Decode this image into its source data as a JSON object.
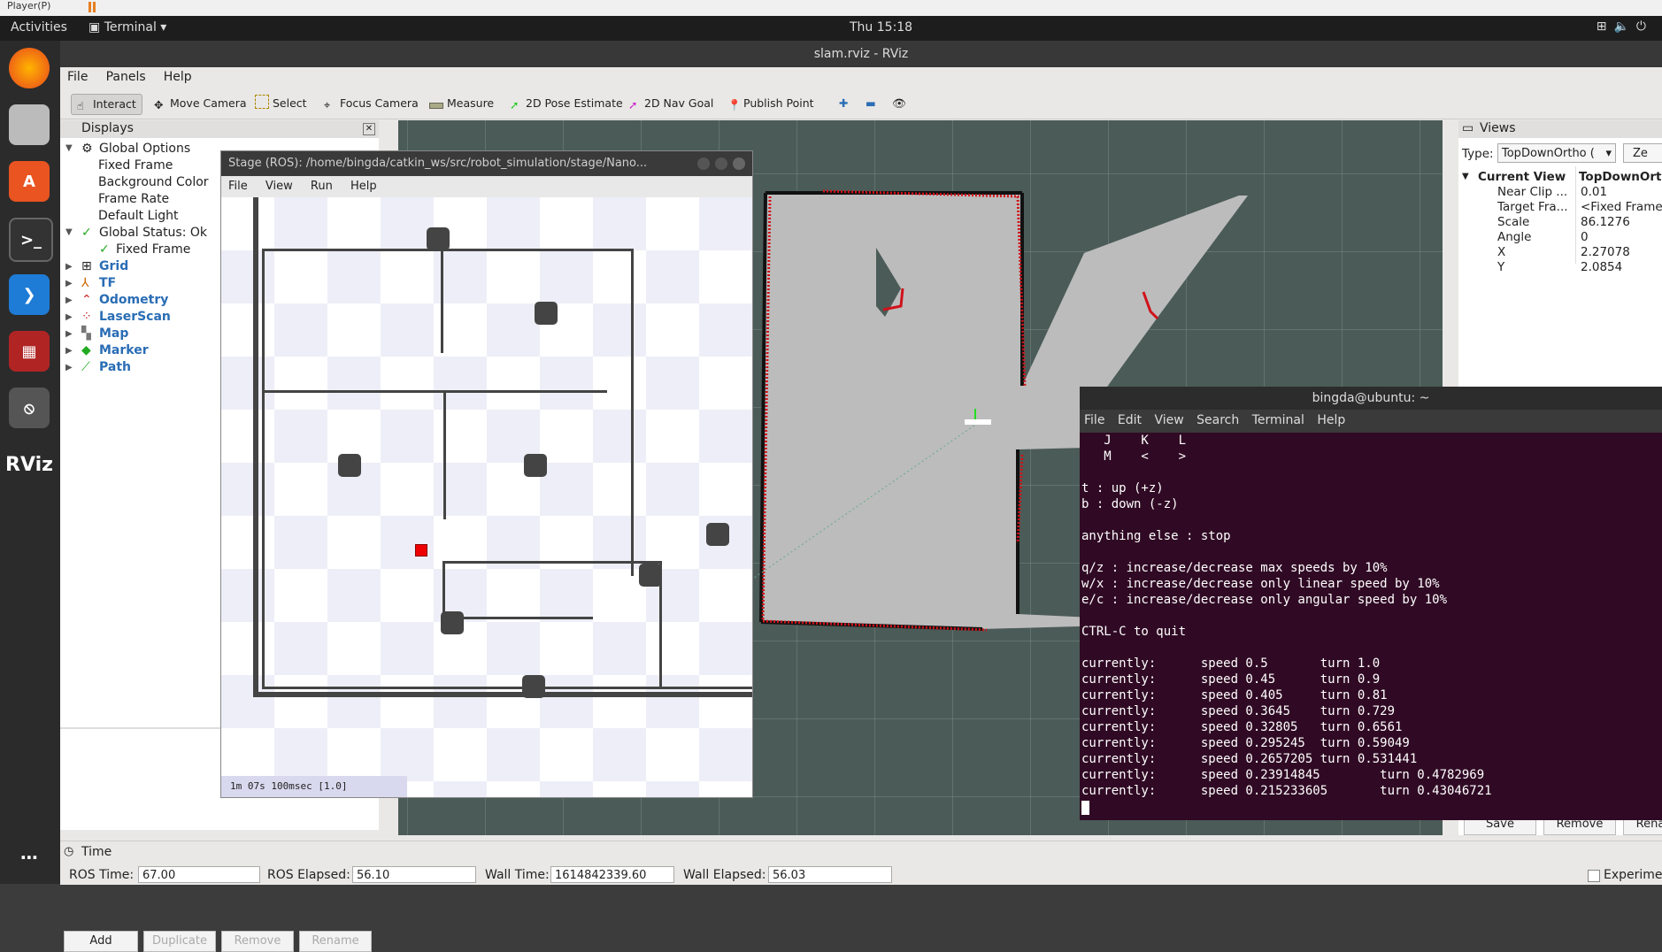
{
  "vm": {
    "player_label": "Player(P)"
  },
  "topbar": {
    "activities": "Activities",
    "app": "Terminal",
    "clock": "Thu 15:18"
  },
  "rviz": {
    "title": "slam.rviz - RViz",
    "menu": [
      "File",
      "Panels",
      "Help"
    ],
    "tools": [
      "Interact",
      "Move Camera",
      "Select",
      "Focus Camera",
      "Measure",
      "2D Pose Estimate",
      "2D Nav Goal",
      "Publish Point"
    ]
  },
  "displays": {
    "header": "Displays",
    "items": {
      "global_options": "Global Options",
      "fixed_frame": "Fixed Frame",
      "background_color": "Background Color",
      "frame_rate": "Frame Rate",
      "default_light": "Default Light",
      "global_status": "Global Status: Ok",
      "status_fixed_frame": "Fixed Frame",
      "grid": "Grid",
      "tf": "TF",
      "odometry": "Odometry",
      "laserscan": "LaserScan",
      "map": "Map",
      "marker": "Marker",
      "path": "Path"
    },
    "buttons": {
      "add": "Add",
      "duplicate": "Duplicate",
      "remove": "Remove",
      "rename": "Rename"
    }
  },
  "stage": {
    "title": "Stage (ROS): /home/bingda/catkin_ws/src/robot_simulation/stage/Nano...",
    "menu": [
      "File",
      "View",
      "Run",
      "Help"
    ],
    "status": "1m 07s 100msec [1.0]"
  },
  "views": {
    "header": "Views",
    "type_label": "Type:",
    "type_value": "TopDownOrtho (",
    "zero_button": "Ze",
    "current_view": "Current View",
    "current_view_value": "TopDownOrtho",
    "props": [
      {
        "name": "Near Clip ...",
        "value": "0.01"
      },
      {
        "name": "Target Fra...",
        "value": "<Fixed Frame"
      },
      {
        "name": "Scale",
        "value": "86.1276"
      },
      {
        "name": "Angle",
        "value": "0"
      },
      {
        "name": "X",
        "value": "2.27078"
      },
      {
        "name": "Y",
        "value": "2.0854"
      }
    ],
    "buttons": {
      "save": "Save",
      "remove": "Remove",
      "rename": "Rena"
    }
  },
  "terminal": {
    "title": "bingda@ubuntu: ~",
    "menu": [
      "File",
      "Edit",
      "View",
      "Search",
      "Terminal",
      "Help"
    ],
    "lines": [
      "   J    K    L",
      "   M    <    >",
      "",
      "t : up (+z)",
      "b : down (-z)",
      "",
      "anything else : stop",
      "",
      "q/z : increase/decrease max speeds by 10%",
      "w/x : increase/decrease only linear speed by 10%",
      "e/c : increase/decrease only angular speed by 10%",
      "",
      "CTRL-C to quit",
      "",
      "currently:      speed 0.5       turn 1.0",
      "currently:      speed 0.45      turn 0.9",
      "currently:      speed 0.405     turn 0.81",
      "currently:      speed 0.3645    turn 0.729",
      "currently:      speed 0.32805   turn 0.6561",
      "currently:      speed 0.295245  turn 0.59049",
      "currently:      speed 0.2657205 turn 0.531441",
      "currently:      speed 0.23914845        turn 0.4782969",
      "currently:      speed 0.215233605       turn 0.43046721"
    ]
  },
  "time": {
    "header": "Time",
    "ros_time_label": "ROS Time:",
    "ros_time": "67.00",
    "ros_elapsed_label": "ROS Elapsed:",
    "ros_elapsed": "56.10",
    "wall_time_label": "Wall Time:",
    "wall_time": "1614842339.60",
    "wall_elapsed_label": "Wall Elapsed:",
    "wall_elapsed": "56.03",
    "experimental": "Experime"
  },
  "colors": {
    "laser": "#d0121b",
    "terminal_bg": "#300a24",
    "map_free": "#bcbcbc",
    "grid_bg": "#4b5b57"
  }
}
